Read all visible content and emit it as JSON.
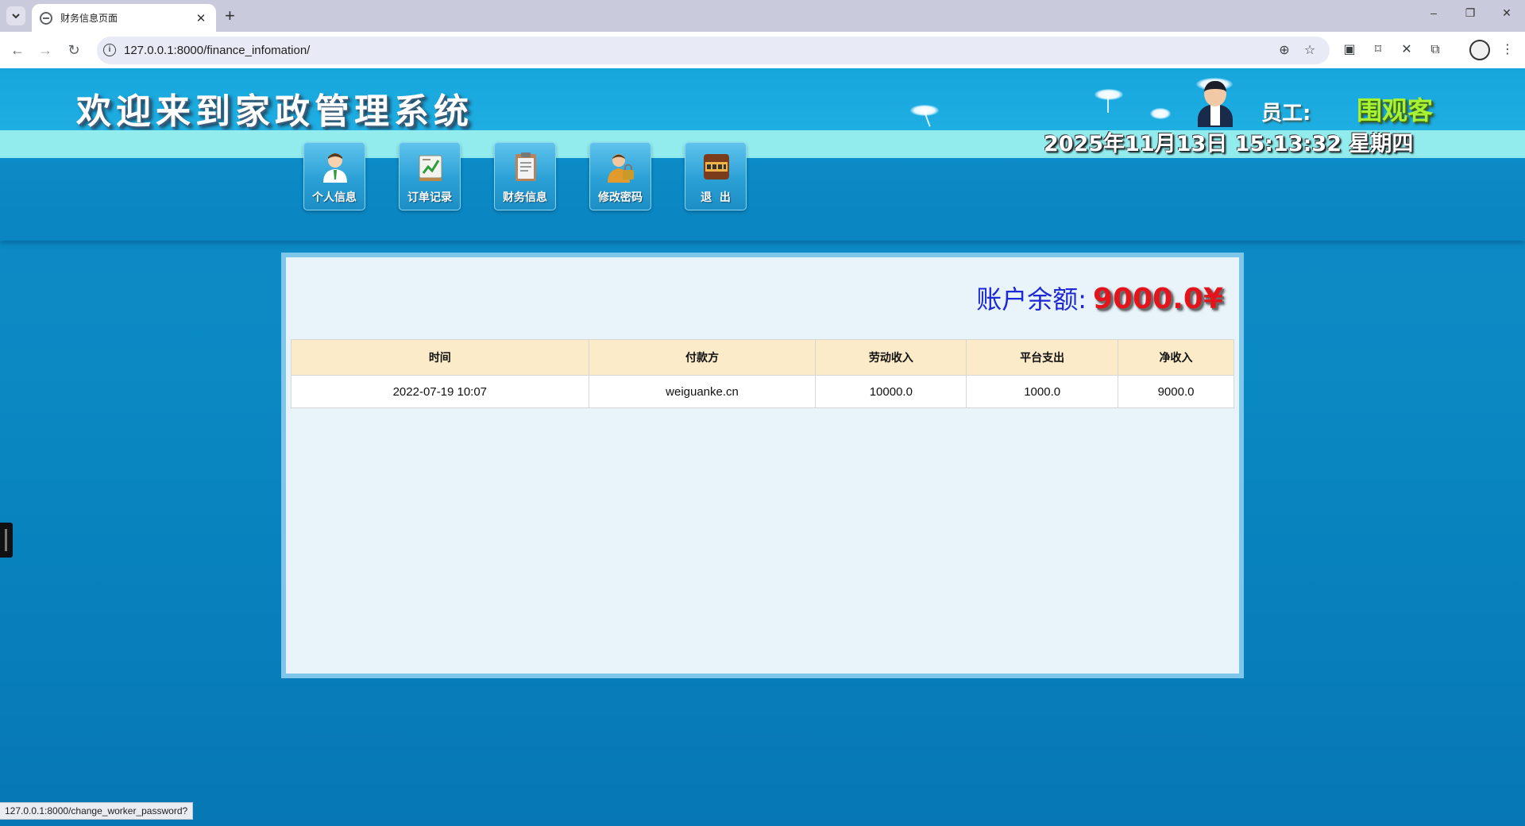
{
  "browser": {
    "tab_title": "财务信息页面",
    "tab_close": "✕",
    "new_tab": "+",
    "url": "127.0.0.1:8000/finance_infomation/",
    "status_url": "127.0.0.1:8000/change_worker_password?",
    "window_controls": {
      "minimize": "–",
      "maximize": "❐",
      "close": "✕"
    },
    "icons": [
      "back-icon",
      "forward-icon",
      "reload-icon",
      "site-info-icon",
      "zoom-icon",
      "star-icon",
      "extension-icon",
      "bookmark-icon",
      "close-x-icon",
      "puzzle-icon",
      "profile-icon",
      "more-icon"
    ]
  },
  "header": {
    "title": "欢迎来到家政管理系统",
    "user_label": "员工:",
    "user_name": "围观客",
    "datetime": "2025年11月13日 15:13:32 星期四"
  },
  "menu": [
    {
      "label": "个人信息",
      "icon": "person-icon"
    },
    {
      "label": "订单记录",
      "icon": "order-record-icon"
    },
    {
      "label": "财务信息",
      "icon": "clipboard-icon"
    },
    {
      "label": "修改密码",
      "icon": "lock-person-icon"
    },
    {
      "label": "退  出",
      "icon": "exit-icon"
    }
  ],
  "balance": {
    "label": "账户余额:",
    "value": "9000.0¥"
  },
  "table": {
    "headers": [
      "时间",
      "付款方",
      "劳动收入",
      "平台支出",
      "净收入"
    ],
    "rows": [
      [
        "2022-07-19 10:07",
        "weiguanke.cn",
        "10000.0",
        "1000.0",
        "9000.0"
      ]
    ]
  },
  "colors": {
    "header_bg": "#16a6dc",
    "band_bg": "#92ecee",
    "balance_label": "#1d28d6",
    "balance_value": "#e3141b",
    "user_name": "#a6f233",
    "table_header_bg": "#fcebc8"
  }
}
